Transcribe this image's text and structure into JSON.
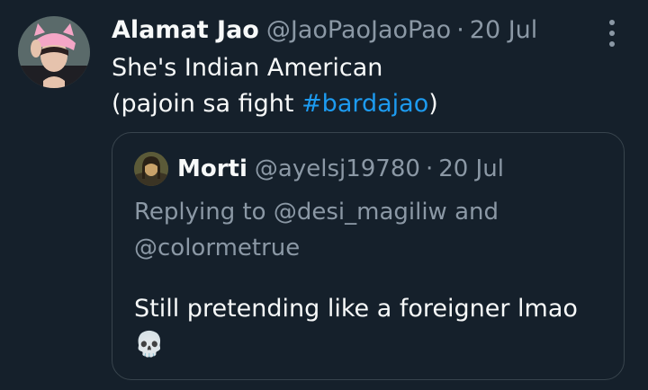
{
  "tweet": {
    "author_name": "Alamat Jao",
    "author_handle": "@JaoPaoJaoPao",
    "separator": "·",
    "date": "20 Jul",
    "text_line1": "She's Indian American",
    "text_line2_prefix": "(pajoin sa fight ",
    "hashtag": "#bardajao",
    "text_line2_suffix": ")",
    "more_icon": "more-vertical-icon"
  },
  "quoted": {
    "author_name": "Morti",
    "author_handle": "@ayelsj19780",
    "separator": "·",
    "date": "20 Jul",
    "replying_line1": "Replying to @desi_magiliw and",
    "replying_line2": "@colormetrue",
    "text_line1": "Still pretending like a foreigner lmao",
    "emoji": "💀"
  },
  "colors": {
    "background": "#15202b",
    "text": "#f7f9f9",
    "muted": "#8b98a5",
    "link": "#1d9bf0",
    "border": "#38444d"
  }
}
